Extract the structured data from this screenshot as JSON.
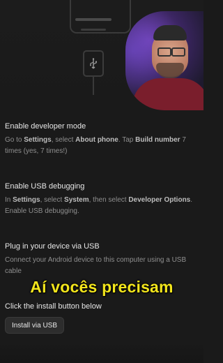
{
  "steps": [
    {
      "title": "Enable developer mode",
      "desc_parts": [
        "Go to ",
        "Settings",
        ", select ",
        "About phone",
        ". Tap ",
        "Build number",
        " 7 times (yes, 7 times!)"
      ]
    },
    {
      "title": "Enable USB debugging",
      "desc_parts": [
        "In ",
        "Settings",
        ", select ",
        "System",
        ", then select ",
        "Developer Options",
        ". Enable USB debugging."
      ]
    },
    {
      "title": "Plug in your device via USB",
      "desc_parts": [
        "Connect your Android device to this computer using a USB cable"
      ]
    },
    {
      "title": "Click the install button below"
    }
  ],
  "install_button": {
    "label": "Install via USB"
  },
  "subtitle": "Aí vocês precisam",
  "colors": {
    "background": "#1a1a1a",
    "subtitle": "#f2e51c",
    "button_bg": "#2d2d2d"
  },
  "icons": {
    "usb": "usb-icon"
  }
}
